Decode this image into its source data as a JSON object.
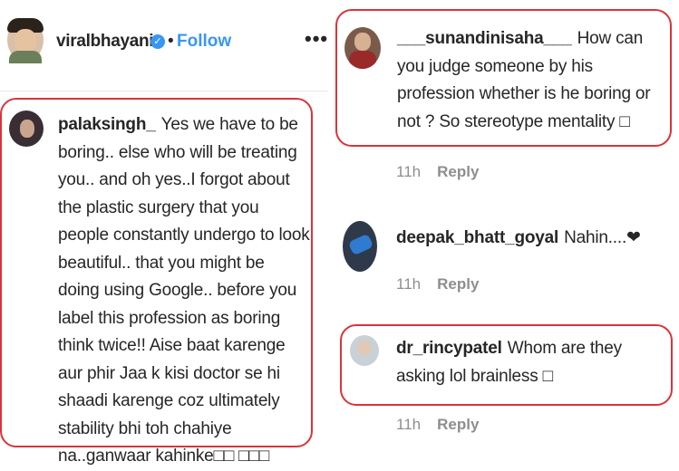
{
  "post_header": {
    "username": "viralbhayani",
    "separator": "•",
    "follow_label": "Follow",
    "more_label": "•••"
  },
  "comments": [
    {
      "username": "palaksingh_",
      "text": "Yes we have to be boring.. else who will be treating you.. and oh yes..I forgot about the plastic surgery that you people constantly undergo to look beautiful.. that you might be doing using Google.. before you label this profession as boring think twice!! Aise baat karenge aur phir Jaa k kisi doctor se hi shaadi karenge coz ultimately stability bhi toh chahiye na..ganwaar kahinke□□ □□□"
    },
    {
      "username": "___sunandinisaha___",
      "text": "How can you judge someone by his profession whether is he boring or not ? So stereotype mentality □",
      "time": "11h",
      "reply_label": "Reply"
    },
    {
      "username": "deepak_bhatt_goyal",
      "text": "Nahin....❤",
      "time": "11h",
      "reply_label": "Reply"
    },
    {
      "username": "dr_rincypatel",
      "text": "Whom are they asking lol brainless □",
      "time": "11h",
      "reply_label": "Reply"
    }
  ],
  "colors": {
    "highlight_border": "#d9343b",
    "follow_blue": "#3897f0",
    "meta_gray": "#8e8e8e"
  },
  "icons": {
    "verified": "verified-badge-icon",
    "more": "more-options-icon"
  }
}
